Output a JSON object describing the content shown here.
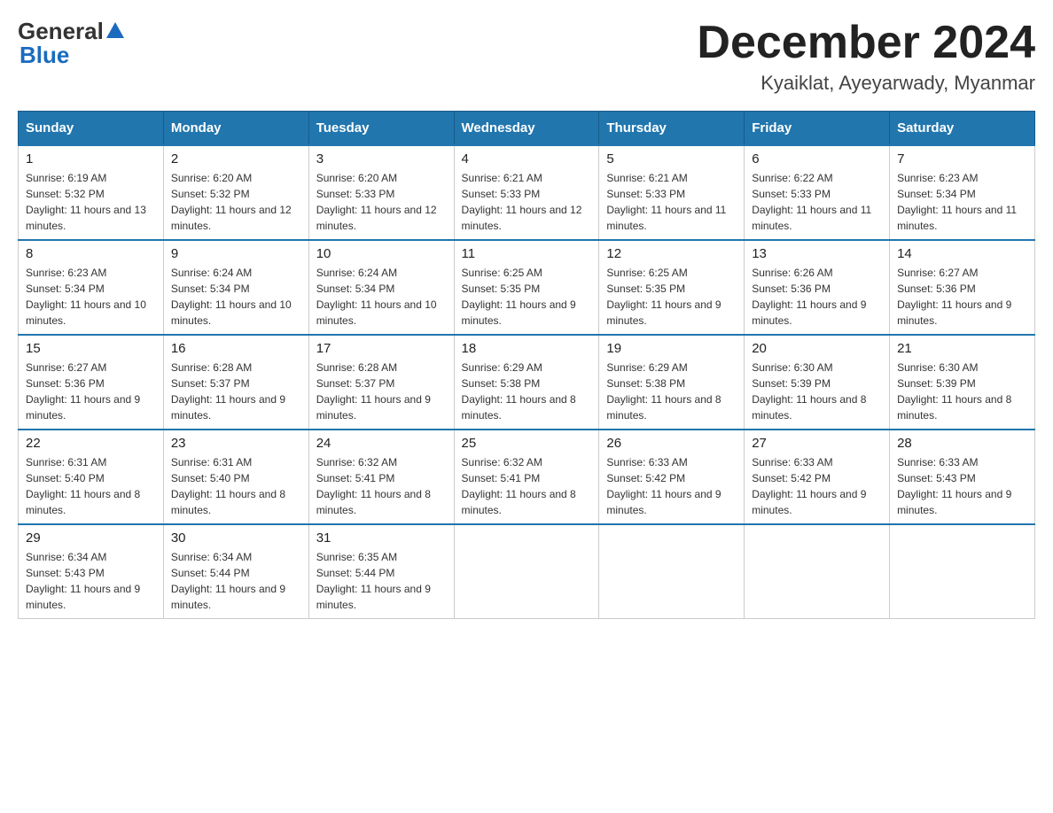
{
  "header": {
    "logo_general": "General",
    "logo_blue": "Blue",
    "month_title": "December 2024",
    "location": "Kyaiklat, Ayeyarwady, Myanmar"
  },
  "days_of_week": [
    "Sunday",
    "Monday",
    "Tuesday",
    "Wednesday",
    "Thursday",
    "Friday",
    "Saturday"
  ],
  "weeks": [
    [
      {
        "day": "1",
        "sunrise": "6:19 AM",
        "sunset": "5:32 PM",
        "daylight": "11 hours and 13 minutes."
      },
      {
        "day": "2",
        "sunrise": "6:20 AM",
        "sunset": "5:32 PM",
        "daylight": "11 hours and 12 minutes."
      },
      {
        "day": "3",
        "sunrise": "6:20 AM",
        "sunset": "5:33 PM",
        "daylight": "11 hours and 12 minutes."
      },
      {
        "day": "4",
        "sunrise": "6:21 AM",
        "sunset": "5:33 PM",
        "daylight": "11 hours and 12 minutes."
      },
      {
        "day": "5",
        "sunrise": "6:21 AM",
        "sunset": "5:33 PM",
        "daylight": "11 hours and 11 minutes."
      },
      {
        "day": "6",
        "sunrise": "6:22 AM",
        "sunset": "5:33 PM",
        "daylight": "11 hours and 11 minutes."
      },
      {
        "day": "7",
        "sunrise": "6:23 AM",
        "sunset": "5:34 PM",
        "daylight": "11 hours and 11 minutes."
      }
    ],
    [
      {
        "day": "8",
        "sunrise": "6:23 AM",
        "sunset": "5:34 PM",
        "daylight": "11 hours and 10 minutes."
      },
      {
        "day": "9",
        "sunrise": "6:24 AM",
        "sunset": "5:34 PM",
        "daylight": "11 hours and 10 minutes."
      },
      {
        "day": "10",
        "sunrise": "6:24 AM",
        "sunset": "5:34 PM",
        "daylight": "11 hours and 10 minutes."
      },
      {
        "day": "11",
        "sunrise": "6:25 AM",
        "sunset": "5:35 PM",
        "daylight": "11 hours and 9 minutes."
      },
      {
        "day": "12",
        "sunrise": "6:25 AM",
        "sunset": "5:35 PM",
        "daylight": "11 hours and 9 minutes."
      },
      {
        "day": "13",
        "sunrise": "6:26 AM",
        "sunset": "5:36 PM",
        "daylight": "11 hours and 9 minutes."
      },
      {
        "day": "14",
        "sunrise": "6:27 AM",
        "sunset": "5:36 PM",
        "daylight": "11 hours and 9 minutes."
      }
    ],
    [
      {
        "day": "15",
        "sunrise": "6:27 AM",
        "sunset": "5:36 PM",
        "daylight": "11 hours and 9 minutes."
      },
      {
        "day": "16",
        "sunrise": "6:28 AM",
        "sunset": "5:37 PM",
        "daylight": "11 hours and 9 minutes."
      },
      {
        "day": "17",
        "sunrise": "6:28 AM",
        "sunset": "5:37 PM",
        "daylight": "11 hours and 9 minutes."
      },
      {
        "day": "18",
        "sunrise": "6:29 AM",
        "sunset": "5:38 PM",
        "daylight": "11 hours and 8 minutes."
      },
      {
        "day": "19",
        "sunrise": "6:29 AM",
        "sunset": "5:38 PM",
        "daylight": "11 hours and 8 minutes."
      },
      {
        "day": "20",
        "sunrise": "6:30 AM",
        "sunset": "5:39 PM",
        "daylight": "11 hours and 8 minutes."
      },
      {
        "day": "21",
        "sunrise": "6:30 AM",
        "sunset": "5:39 PM",
        "daylight": "11 hours and 8 minutes."
      }
    ],
    [
      {
        "day": "22",
        "sunrise": "6:31 AM",
        "sunset": "5:40 PM",
        "daylight": "11 hours and 8 minutes."
      },
      {
        "day": "23",
        "sunrise": "6:31 AM",
        "sunset": "5:40 PM",
        "daylight": "11 hours and 8 minutes."
      },
      {
        "day": "24",
        "sunrise": "6:32 AM",
        "sunset": "5:41 PM",
        "daylight": "11 hours and 8 minutes."
      },
      {
        "day": "25",
        "sunrise": "6:32 AM",
        "sunset": "5:41 PM",
        "daylight": "11 hours and 8 minutes."
      },
      {
        "day": "26",
        "sunrise": "6:33 AM",
        "sunset": "5:42 PM",
        "daylight": "11 hours and 9 minutes."
      },
      {
        "day": "27",
        "sunrise": "6:33 AM",
        "sunset": "5:42 PM",
        "daylight": "11 hours and 9 minutes."
      },
      {
        "day": "28",
        "sunrise": "6:33 AM",
        "sunset": "5:43 PM",
        "daylight": "11 hours and 9 minutes."
      }
    ],
    [
      {
        "day": "29",
        "sunrise": "6:34 AM",
        "sunset": "5:43 PM",
        "daylight": "11 hours and 9 minutes."
      },
      {
        "day": "30",
        "sunrise": "6:34 AM",
        "sunset": "5:44 PM",
        "daylight": "11 hours and 9 minutes."
      },
      {
        "day": "31",
        "sunrise": "6:35 AM",
        "sunset": "5:44 PM",
        "daylight": "11 hours and 9 minutes."
      },
      null,
      null,
      null,
      null
    ]
  ],
  "labels": {
    "sunrise": "Sunrise:",
    "sunset": "Sunset:",
    "daylight": "Daylight:"
  }
}
